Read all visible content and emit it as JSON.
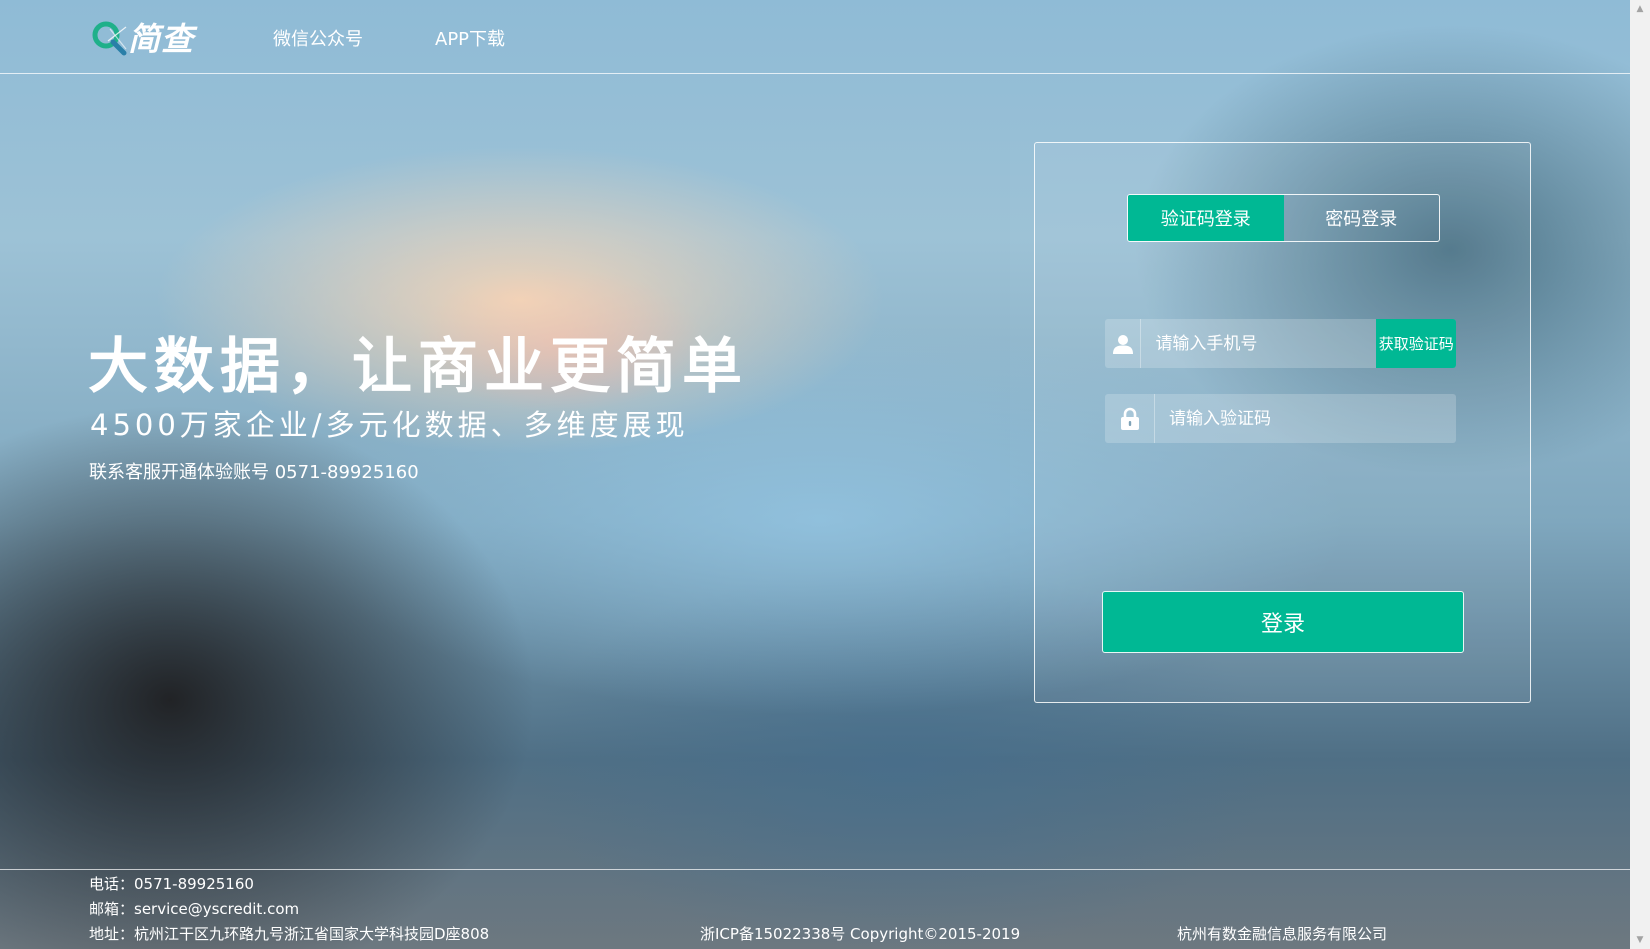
{
  "header": {
    "logo_text": "简查",
    "nav": {
      "wechat": "微信公众号",
      "app": "APP下载"
    }
  },
  "hero": {
    "title": "大数据，让商业更简单",
    "subtitle": "4500万家企业/多元化数据、多维度展现",
    "contact": "联系客服开通体验账号 0571-89925160"
  },
  "login": {
    "tabs": [
      {
        "label": "验证码登录",
        "active": true
      },
      {
        "label": "密码登录",
        "active": false
      }
    ],
    "phone_placeholder": "请输入手机号",
    "phone_icon": "user-icon",
    "get_code_label": "获取验证码",
    "code_placeholder": "请输入验证码",
    "code_icon": "lock-icon",
    "submit_label": "登录"
  },
  "footer": {
    "phone": "电话：0571-89925160",
    "email": "邮箱：service@yscredit.com",
    "address": "地址：杭州江干区九环路九号浙江省国家大学科技园D座808",
    "icp": "浙ICP备15022338号 Copyright©2015-2019",
    "company": "杭州有数金融信息服务有限公司"
  },
  "colors": {
    "accent": "#00b894",
    "text": "#ffffff"
  }
}
